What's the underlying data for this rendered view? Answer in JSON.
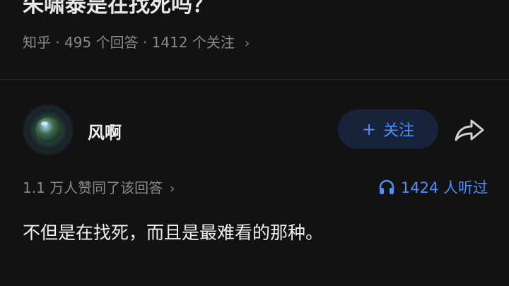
{
  "question": {
    "title": "朱啸泰是在找死吗？",
    "meta": "知乎 · 495 个回答 · 1412 个关注",
    "chevron": "›"
  },
  "author": {
    "name": "风啊",
    "avatar_icon": "camera-lens-avatar"
  },
  "follow_button": {
    "plus": "+",
    "label": "关注"
  },
  "share_icon": "share-arrow-icon",
  "answer_stats": {
    "likes": "1.1 万人赞同了该回答",
    "chevron": "›",
    "listens": "1424 人听过",
    "listen_icon": "headphones-icon"
  },
  "answer": {
    "text": "不但是在找死，而且是最难看的那种。"
  },
  "colors": {
    "background": "#121212",
    "accent": "#4f8ff7",
    "muted_text": "#8a8a8a",
    "follow_bg": "#16233a"
  }
}
